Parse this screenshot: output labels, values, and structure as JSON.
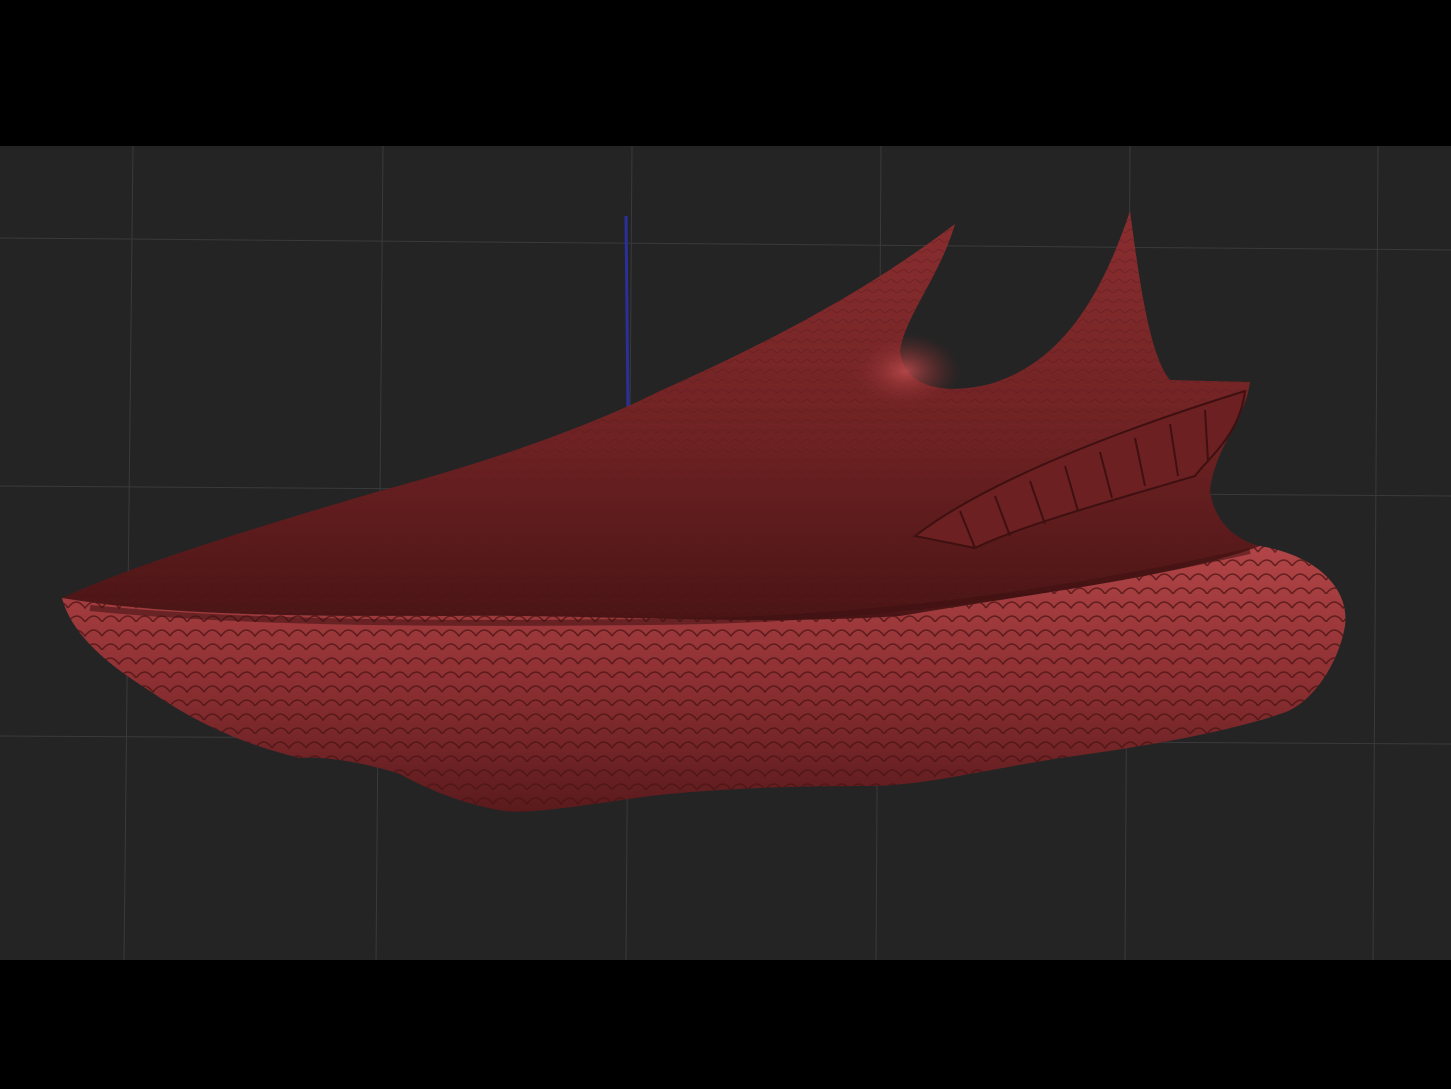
{
  "viewport": {
    "background": "#242424",
    "grid_color": "#3a3a3a",
    "axis_colors": {
      "z_axis": "#2a2f9a",
      "y_axis": "#3aa53a"
    }
  },
  "model": {
    "name_icon": "sneaker-sculpt-model",
    "base_color": "#7a2526",
    "highlight_color": "#b24547",
    "shadow_color": "#3e1011"
  }
}
